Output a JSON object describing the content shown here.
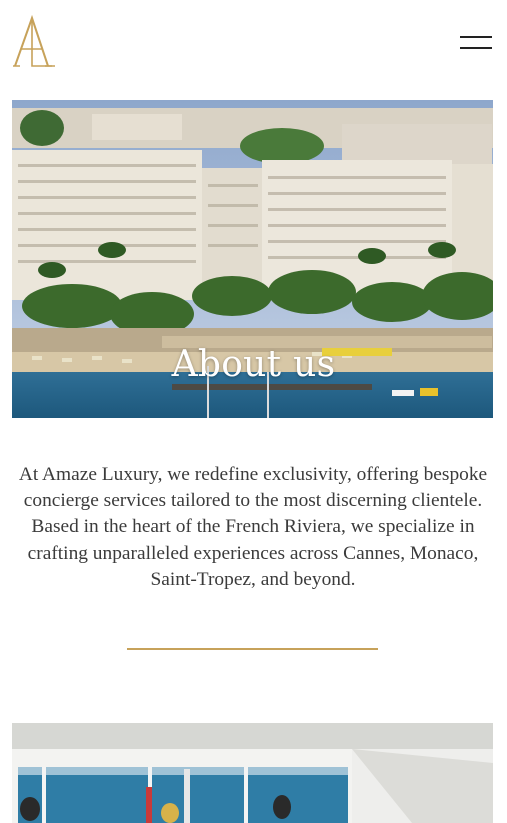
{
  "header": {
    "logo_text": "AL",
    "menu_icon": "hamburger-menu-icon"
  },
  "hero": {
    "title": "About us"
  },
  "about": {
    "text": "At Amaze Luxury, we redefine exclusivity, offering bespoke concierge services tailored to the most discerning clientele. Based in the heart of the French Riviera, we specialize in crafting unparalleled experiences across Cannes, Monaco, Saint-Tropez, and beyond."
  },
  "colors": {
    "gold": "#c7a25a",
    "text": "#3b3b3b",
    "background": "#ffffff"
  }
}
